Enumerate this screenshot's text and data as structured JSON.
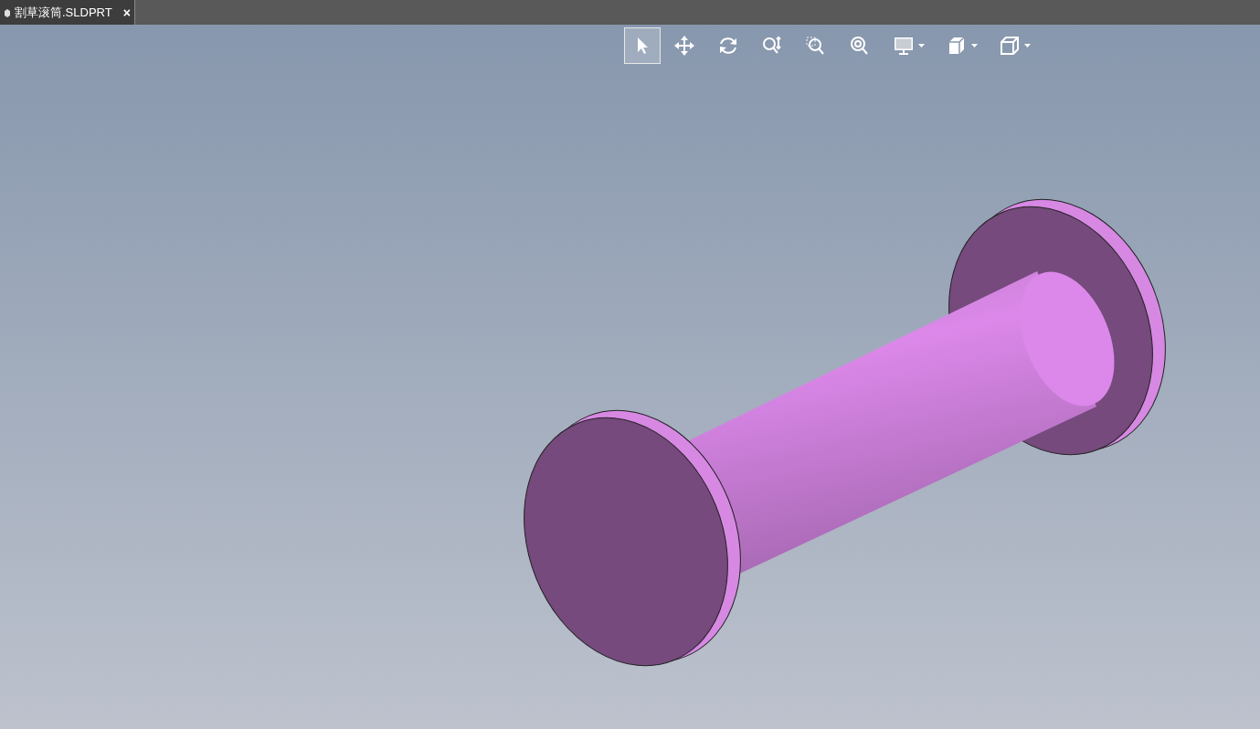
{
  "tab": {
    "title": "割草滚筒.SLDPRT",
    "close": "×",
    "selected": true
  },
  "toolbar": [
    {
      "kind": "select",
      "selected": true,
      "dropdown": false
    },
    {
      "kind": "pan",
      "selected": false,
      "dropdown": false
    },
    {
      "kind": "rotate",
      "selected": false,
      "dropdown": false
    },
    {
      "kind": "zoom",
      "selected": false,
      "dropdown": false
    },
    {
      "kind": "zoomarea",
      "selected": false,
      "dropdown": false
    },
    {
      "kind": "zoomfit",
      "selected": false,
      "dropdown": false
    },
    {
      "kind": "display",
      "selected": false,
      "dropdown": true
    },
    {
      "kind": "section",
      "selected": false,
      "dropdown": true
    },
    {
      "kind": "view",
      "selected": false,
      "dropdown": true
    }
  ]
}
